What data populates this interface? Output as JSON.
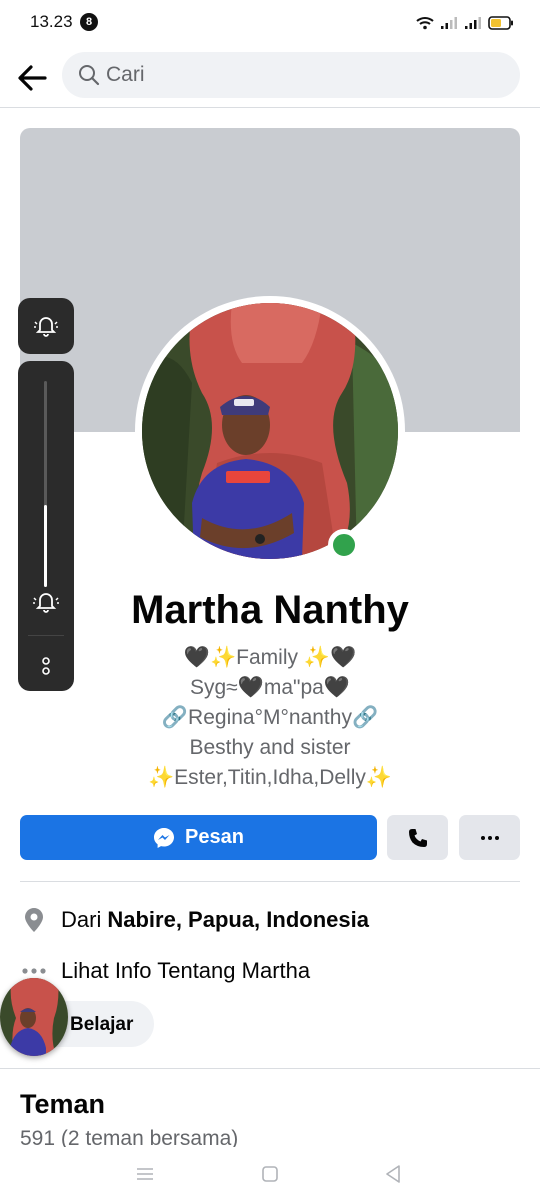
{
  "status_bar": {
    "time": "13.23",
    "notification_count": "8"
  },
  "search": {
    "placeholder": "Cari"
  },
  "profile": {
    "name": "Martha Nanthy",
    "online": true,
    "bio_lines": [
      "🖤✨Family ✨🖤",
      "Syg≈🖤ma\"pa🖤",
      "🔗Regina°M°nanthy🔗",
      "Besthy and sister",
      "✨Ester,Titin,Idha,Delly✨"
    ]
  },
  "actions": {
    "message_label": "Pesan",
    "call_icon": "phone-icon",
    "more_icon": "more-icon"
  },
  "info": {
    "location_prefix": "Dari",
    "location": "Nabire, Papua, Indonesia",
    "about_label": "Lihat Info Tentang Martha"
  },
  "learn_chip": {
    "label": "Belajar"
  },
  "friends": {
    "title": "Teman",
    "count_text": "591 (2 teman bersama)"
  },
  "volume_overlay": {
    "level": 0.4
  },
  "colors": {
    "primary": "#1b74e4",
    "online": "#31a24c",
    "cover": "#c9ccd1"
  }
}
